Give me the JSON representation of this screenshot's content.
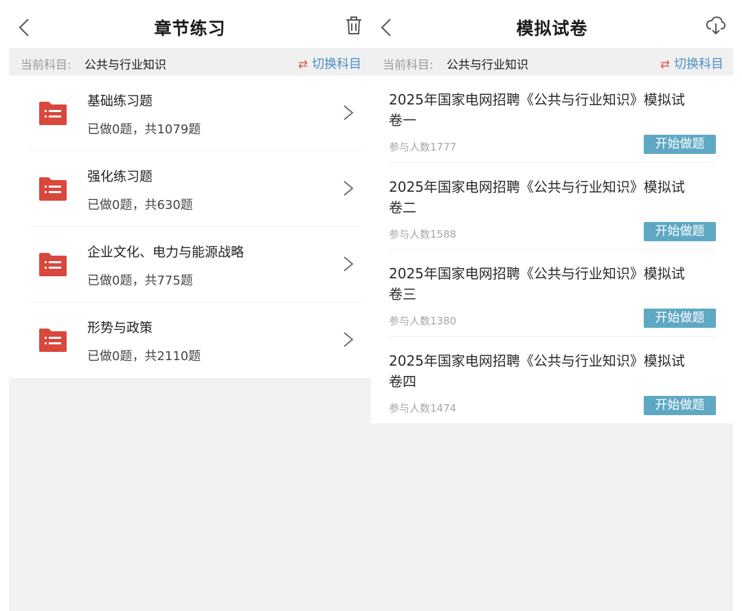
{
  "left": {
    "nav": {
      "title": "章节练习",
      "back_icon": "chevron-left-icon",
      "action_icon": "trash-icon"
    },
    "subject": {
      "label": "当前科目:",
      "value": "公共与行业知识",
      "switch_label": "切换科目",
      "switch_icon": "⇄"
    },
    "chapters": [
      {
        "name": "基础练习题",
        "progress": "已做0题，共1079题"
      },
      {
        "name": "强化练习题",
        "progress": "已做0题，共630题"
      },
      {
        "name": "企业文化、电力与能源战略",
        "progress": "已做0题，共775题"
      },
      {
        "name": "形势与政策",
        "progress": "已做0题，共2110题"
      }
    ]
  },
  "right": {
    "nav": {
      "title": "模拟试卷",
      "back_icon": "chevron-left-icon",
      "action_icon": "cloud-download-icon"
    },
    "subject": {
      "label": "当前科目:",
      "value": "公共与行业知识",
      "switch_label": "切换科目",
      "switch_icon": "⇄"
    },
    "papers": [
      {
        "title": "2025年国家电网招聘《公共与行业知识》模拟试卷一",
        "count": "参与人数1777",
        "button": "开始做题"
      },
      {
        "title": "2025年国家电网招聘《公共与行业知识》模拟试卷二",
        "count": "参与人数1588",
        "button": "开始做题"
      },
      {
        "title": "2025年国家电网招聘《公共与行业知识》模拟试卷三",
        "count": "参与人数1380",
        "button": "开始做题"
      },
      {
        "title": "2025年国家电网招聘《公共与行业知识》模拟试卷四",
        "count": "参与人数1474",
        "button": "开始做题"
      }
    ]
  },
  "colors": {
    "accent_blue": "#4a90c2",
    "folder_red": "#d9473d",
    "button_blue": "#5fa8c4",
    "switch_red": "#d9534f"
  }
}
